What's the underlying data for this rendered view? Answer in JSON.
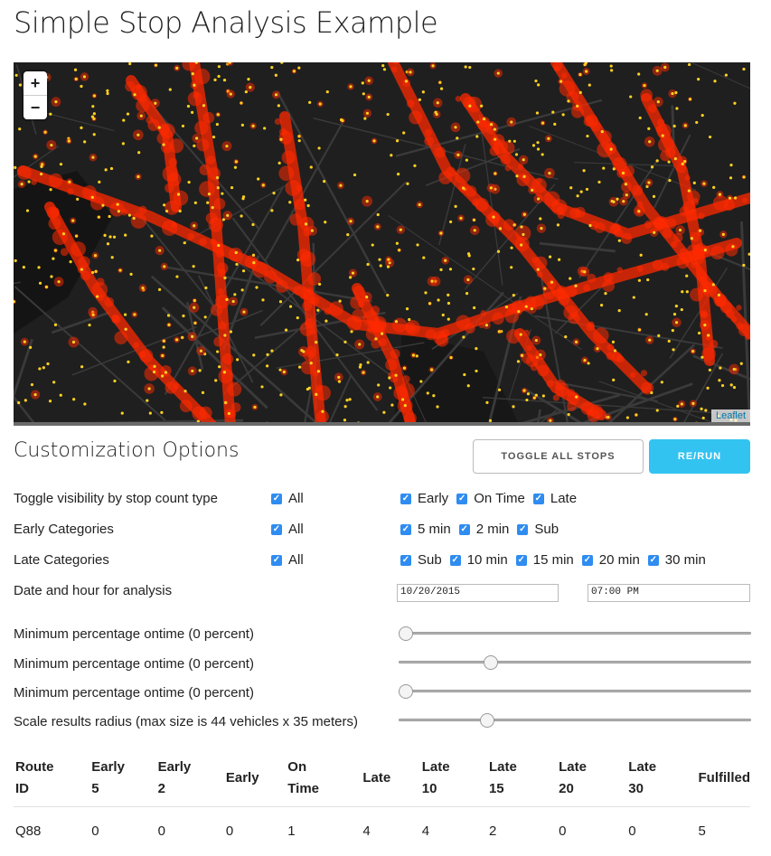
{
  "page": {
    "title": "Simple Stop Analysis Example"
  },
  "map": {
    "zoom_in": "+",
    "zoom_out": "−",
    "attribution": "Leaflet",
    "colors": {
      "background": "#1f1f1f",
      "road": "#3a3a3a",
      "heat": "#ff2a00",
      "stop": "#ffd21f"
    }
  },
  "options": {
    "heading": "Customization Options",
    "toggle_all_label": "TOGGLE ALL STOPS",
    "rerun_label": "RE/RUN",
    "rows": {
      "visibility": {
        "label": "Toggle visibility by stop count type",
        "all": "All",
        "items": [
          "Early",
          "On Time",
          "Late"
        ]
      },
      "early": {
        "label": "Early Categories",
        "all": "All",
        "items": [
          "5 min",
          "2 min",
          "Sub"
        ]
      },
      "late": {
        "label": "Late Categories",
        "all": "All",
        "items": [
          "Sub",
          "10 min",
          "15 min",
          "20 min",
          "30 min"
        ]
      }
    },
    "date_label": "Date and hour for analysis",
    "date_value": "10/20/2015",
    "time_value": "07:00 PM",
    "sliders": [
      {
        "label": "Minimum percentage ontime (0 percent)",
        "value": 0.0
      },
      {
        "label": "Minimum percentage ontime (0 percent)",
        "value": 0.25
      },
      {
        "label": "Minimum percentage ontime (0 percent)",
        "value": 0.0
      },
      {
        "label": "Scale results radius (max size is 44 vehicles x 35 meters)",
        "value": 0.24
      }
    ]
  },
  "table": {
    "headers": [
      [
        "Route",
        "ID"
      ],
      [
        "Early",
        "5"
      ],
      [
        "Early",
        "2"
      ],
      [
        "Early"
      ],
      [
        "On",
        "Time"
      ],
      [
        "Late"
      ],
      [
        "Late",
        "10"
      ],
      [
        "Late",
        "15"
      ],
      [
        "Late",
        "20"
      ],
      [
        "Late",
        "30"
      ],
      [
        "Fulfilled"
      ]
    ],
    "rows": [
      [
        "Q88",
        "0",
        "0",
        "0",
        "1",
        "4",
        "4",
        "2",
        "0",
        "0",
        "5"
      ]
    ]
  }
}
